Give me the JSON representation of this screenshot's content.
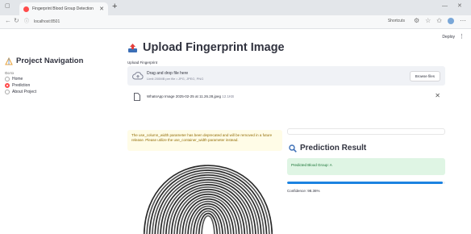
{
  "browser": {
    "tab_title": "Fingerprint Blood Group Detection",
    "url": "localhost:8501",
    "shortcuts_label": "Shortcuts"
  },
  "header": {
    "deploy_label": "Deploy"
  },
  "sidebar": {
    "title": "Project Navigation",
    "goto_label": "Go to",
    "options": [
      {
        "label": "Home",
        "selected": false
      },
      {
        "label": "Prediction",
        "selected": true
      },
      {
        "label": "About Project",
        "selected": false
      }
    ]
  },
  "main": {
    "title": "Upload Fingerprint Image",
    "uploader_label": "Upload Fingerprint",
    "dropzone": {
      "title": "Drag and drop file here",
      "subtitle": "Limit 200MB per file • JPG, JPEG, PNG",
      "browse_label": "Browse files"
    },
    "file": {
      "name": "WhatsApp Image 2025-02-25 at 11.26.28.jpeg",
      "size": "12.1KB"
    },
    "warning": "The use_column_width parameter has been deprecated and will be removed in a future release. Please utilize the use_container_width parameter instead.",
    "prediction": {
      "heading": "Prediction Result",
      "result": "Predicted Blood Group: A",
      "confidence_label": "Confidence: 98.36%",
      "confidence_value": 0.9836
    }
  },
  "colors": {
    "accent": "#ff4b4b",
    "success_bg": "#dff5e4",
    "warning_bg": "#fffce7",
    "progress": "#1c83e1"
  }
}
